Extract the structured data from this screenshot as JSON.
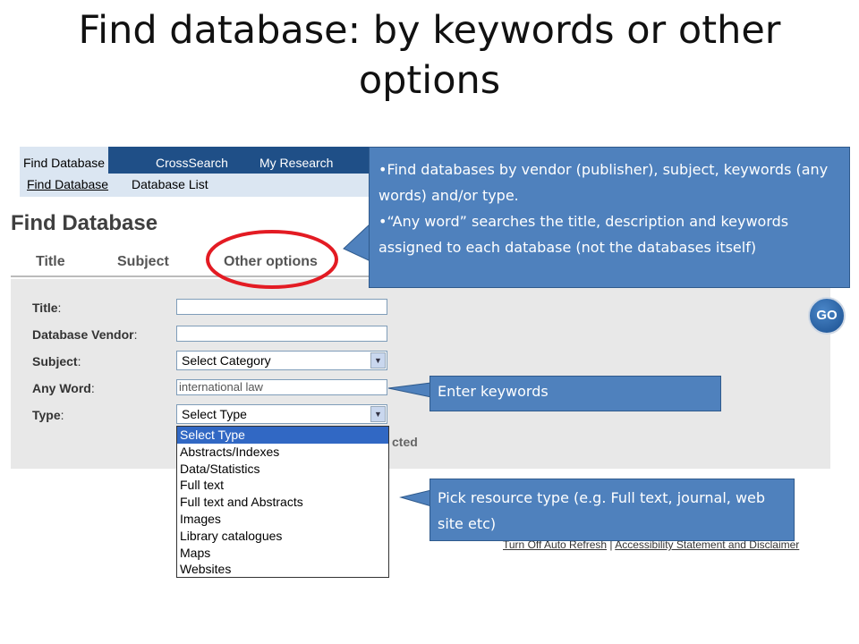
{
  "title": "Find database: by keywords or other options",
  "nav": {
    "top_tabs": [
      "Find Database",
      "CrossSearch",
      "My Research"
    ],
    "sub_tabs": [
      "Find Database",
      "Database List"
    ]
  },
  "page_heading": "Find Database",
  "search_tabs": [
    "Title",
    "Subject",
    "Other options"
  ],
  "form": {
    "labels": {
      "title": "Title",
      "vendor": "Database Vendor",
      "subject": "Subject",
      "any_word": "Any Word",
      "type": "Type"
    },
    "colon": ":",
    "title_value": "",
    "vendor_value": "",
    "subject_selected": "Select Category",
    "any_word_value": "international law",
    "type_selected": "Select Type"
  },
  "type_options": [
    "Select Type",
    "Abstracts/Indexes",
    "Data/Statistics",
    "Full text",
    "Full text and Abstracts",
    "Images",
    "Library catalogues",
    "Maps",
    "Websites"
  ],
  "partial_text": "cted",
  "go_button": "GO",
  "footer": {
    "link1": "Turn Off Auto Refresh",
    "separator": "|",
    "link2": "Accessibility Statement and Disclaimer"
  },
  "callouts": {
    "info_bullet": "•",
    "info_1": "Find databases by vendor (publisher), subject, keywords (any words) and/or type.",
    "info_2": "“Any word” searches the title, description and keywords assigned to each database (not the databases itself)",
    "keywords": "Enter keywords",
    "type": "Pick resource type (e.g. Full text, journal, web site etc)"
  },
  "colors": {
    "callout": "#4f81bd",
    "highlight_ring": "#e31b23",
    "nav": "#1f4f87"
  }
}
